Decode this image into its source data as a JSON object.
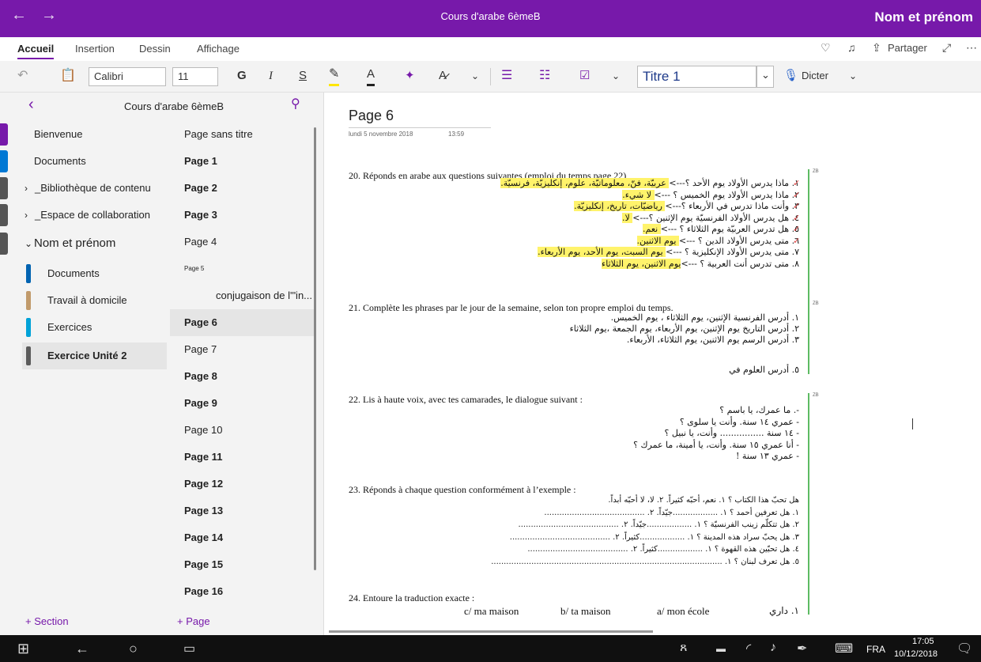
{
  "titlebar": {
    "back": "←",
    "forward": "→",
    "title": "Cours d'arabe 6èmeB",
    "user": "Nom et prénom"
  },
  "tabs": {
    "items": [
      "Accueil",
      "Insertion",
      "Dessin",
      "Affichage"
    ],
    "share": "Partager"
  },
  "toolbar": {
    "font": "Calibri",
    "size": "11",
    "bold": "G",
    "italic": "I",
    "underline": "S",
    "style": "Titre 1",
    "dictate": "Dicter"
  },
  "notebook": {
    "name": "Cours d'arabe 6èmeB",
    "add_section": "+ Section",
    "add_page": "+ Page"
  },
  "sections": [
    {
      "label": "Bienvenue",
      "color": "#7719aa"
    },
    {
      "label": "Documents",
      "color": "#0078d4"
    },
    {
      "label": "_Bibliothèque de contenu",
      "color": "#555555"
    },
    {
      "label": "_Espace de collaboration",
      "color": "#555555"
    },
    {
      "label": "Nom et prénom",
      "color": "#555555"
    }
  ],
  "subsections": [
    {
      "label": "Documents",
      "color": "#0063b1"
    },
    {
      "label": "Travail à domicile",
      "color": "#c19a6b"
    },
    {
      "label": "Exercices",
      "color": "#00a2d8"
    },
    {
      "label": "Exercice Unité 2",
      "color": "#5b5b5b"
    }
  ],
  "pages": [
    "Page sans titre",
    "Page 1",
    "Page 2",
    "Page 3",
    "Page 4",
    "Page 5",
    "conjugaison de l'\"in...",
    "Page 6",
    "Page 7",
    "Page 8",
    "Page 9",
    "Page 10",
    "Page 11",
    "Page 12",
    "Page 13",
    "Page 14",
    "Page 15",
    "Page 16"
  ],
  "page": {
    "title": "Page 6",
    "date": "lundi 5 novembre 2018",
    "time": "13:59",
    "q20": "20. Réponds en arabe aux questions suivantes (emploi du temps page 22)",
    "q20_lines": [
      "١. ماذا يدرس الأولاد يوم الأحد ؟---> عربيّة، فنّ، معلوماتيّة، علوم، إنكليزيّة، فرنسيّة.",
      "٢. ماذا يدرس الأولاد يوم الخميس ؟ ---> لا شيء.",
      "٣. وأنت ماذا تدرس في الأربعاء ؟---> رياضيّات، تاريخ، إنكليزيّة.",
      "٤. هل يدرس الأولاد الفرنسيّة يوم الإثنين ؟---> لا.",
      "٥. هل تدرس العربيّة يوم الثلاثاء ؟ ---> نعم.",
      "٦. متى يدرس الأولاد الدين ؟ ---> يوم الاثنين.",
      "٧. متى يدرس الأولاد الإنكليزية ؟ ---> يوم السبت، يوم الأحد، يوم الأربعاء.",
      "٨. متى تدرس أنت العربية ؟ --->يوم الاثنين، يوم الثلاثاء"
    ],
    "q21": "21. Complète les phrases par le jour de la semaine, selon ton propre emploi du temps.",
    "q21_lines": [
      "١. أدرس الفرنسية الإثنين، يوم الثلاثاء ، يوم الخميس.",
      "٢. أدرس التاريخ يوم الإثنين، يوم الأربعاء، يوم الجمعة ،يوم الثلاثاء",
      "٣. أدرس الرسم يوم الاثنين، يوم الثلاثاء، الأربعاء.",
      "٥. أدرس العلوم في"
    ],
    "q22": "22. Lis à haute voix, avec tes camarades, le dialogue suivant :",
    "q22_lines": [
      "-. ما عمرك، يا باسم ؟",
      "- عمري ١٤ سنة. وأنت يا سلوى ؟",
      "- ١٤ سنة ................ وأنت، يا نبيل ؟",
      "- أنا عمري ١٥ سنة. وأنت، يا أمينة، ما عمرك ؟",
      "- عمري ١٣ سنة !"
    ],
    "q23": "23. Réponds à chaque question conformément à l’exemple :",
    "q23_lines": [
      "هل تحبّ هذا الكتاب ؟ ١. نعم، أحبّه كثيراً. ٢. لا، لا أحبّه أبداً.",
      "١. هل تعرفين أحمد ؟ ١. ..................جيّداً. ٢. ........................................",
      "٢. هل تتكلّم زينب الفرنسيّة ؟ ١. ..................جيّداً. ٢. ........................................",
      "٣. هل يحبّ سراد هذه المدينة ؟ ١. ..................كثيراً. ٢. ........................................",
      "٤. هل تحبّين هذه القهوة ؟ ١. ..................كثيراً. ٢. ........................................",
      "٥. هل تعرف لبنان ؟ ١. ............................................................................................"
    ],
    "q24": "24. Entoure la traduction exacte :",
    "q24_line": {
      "ar": "١. داري",
      "a": "a/ mon école",
      "b": "b/ ta maison",
      "c": "c/ ma maison"
    },
    "zb": "ZB"
  },
  "taskbar": {
    "lang": "FRA",
    "time": "17:05",
    "date": "10/12/2018"
  }
}
